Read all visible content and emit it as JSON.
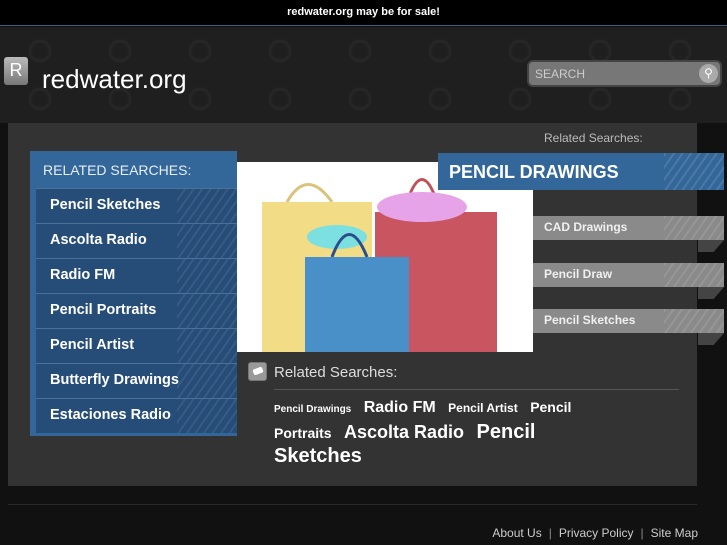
{
  "topbar": {
    "text": "redwater.org may be for sale!"
  },
  "header": {
    "logo_letter": "R",
    "site_name": "redwater.org",
    "search_placeholder": "SEARCH"
  },
  "main": {
    "related_top": "Related Searches:",
    "left_title": "RELATED SEARCHES:",
    "left_items": [
      "Pencil Sketches",
      "Ascolta Radio",
      "Radio FM",
      "Pencil Portraits",
      "Pencil Artist",
      "Butterfly Drawings",
      "Estaciones Radio"
    ],
    "banner": "PENCIL DRAWINGS",
    "right_items": [
      "CAD Drawings",
      "Pencil Draw",
      "Pencil Sketches"
    ],
    "related_bottom": "Related Searches:",
    "cloud": [
      {
        "label": "Pencil Drawings",
        "size": 10
      },
      {
        "label": "Radio FM",
        "size": 16
      },
      {
        "label": "Pencil Artist",
        "size": 12
      },
      {
        "label": "Pencil Portraits",
        "size": 14
      },
      {
        "label": "Ascolta Radio",
        "size": 18
      },
      {
        "label": "Pencil Sketches",
        "size": 20
      }
    ]
  },
  "footer": {
    "links": [
      "About Us",
      "Privacy Policy",
      "Site Map"
    ]
  }
}
